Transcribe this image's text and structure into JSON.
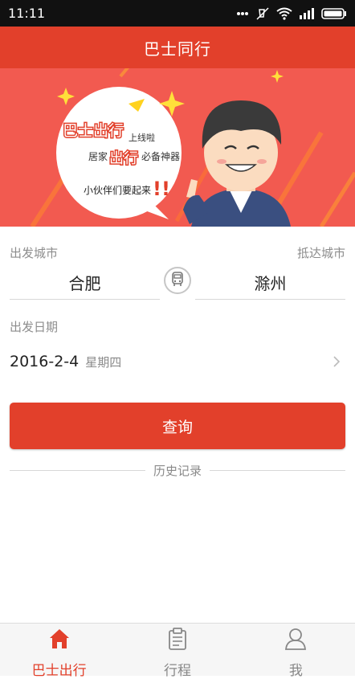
{
  "status_bar": {
    "time": "11:11"
  },
  "header": {
    "title": "巴士同行"
  },
  "banner": {
    "line1": "巴士出行",
    "line1_suffix": "上线啦",
    "line2_prefix": "居家",
    "line2_highlight": "出行",
    "line2_suffix": "必备神器",
    "line3": "小伙伴们要起来",
    "accent_color": "#f25a50"
  },
  "search": {
    "from_label": "出发城市",
    "to_label": "抵达城市",
    "from_city": "合肥",
    "to_city": "滁州",
    "date_label": "出发日期",
    "date": "2016-2-4",
    "weekday": "星期四",
    "query_button": "查询",
    "history_label": "历史记录"
  },
  "tabs": [
    {
      "label": "巴士出行",
      "icon": "home-icon",
      "active": true
    },
    {
      "label": "行程",
      "icon": "clipboard-icon",
      "active": false
    },
    {
      "label": "我",
      "icon": "user-icon",
      "active": false
    }
  ],
  "colors": {
    "primary": "#e2402b",
    "text_muted": "#8a8a8a"
  }
}
